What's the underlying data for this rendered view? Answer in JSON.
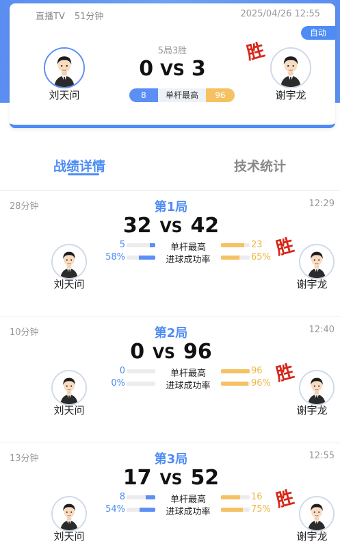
{
  "header": {
    "source": "直播TV",
    "duration": "51分钟",
    "datetime": "2025/04/26 12:55",
    "auto_label": "自动"
  },
  "match": {
    "format": "5局3胜",
    "left_player": "刘天问",
    "right_player": "谢宇龙",
    "left_score": "0",
    "right_score": "3",
    "vs": "VS",
    "highest_break_label": "单杆最高",
    "left_highest_break": "8",
    "right_highest_break": "96",
    "win_mark": "胜"
  },
  "tabs": [
    {
      "label": "战绩详情",
      "active": true
    },
    {
      "label": "技术统计",
      "active": false
    }
  ],
  "frames": [
    {
      "title": "第1局",
      "duration": "28分钟",
      "time": "12:29",
      "left_score": "32",
      "right_score": "42",
      "left_player": "刘天问",
      "right_player": "谢宇龙",
      "winner": "right",
      "stats": [
        {
          "label": "单杆最高",
          "left": "5",
          "right": "23",
          "left_frac": 0.18,
          "right_frac": 0.82
        },
        {
          "label": "进球成功率",
          "left": "58%",
          "right": "65%",
          "left_frac": 0.58,
          "right_frac": 0.65
        }
      ]
    },
    {
      "title": "第2局",
      "duration": "10分钟",
      "time": "12:40",
      "left_score": "0",
      "right_score": "96",
      "left_player": "刘天问",
      "right_player": "谢宇龙",
      "winner": "right",
      "stats": [
        {
          "label": "单杆最高",
          "left": "0",
          "right": "96",
          "left_frac": 0.0,
          "right_frac": 1.0
        },
        {
          "label": "进球成功率",
          "left": "0%",
          "right": "96%",
          "left_frac": 0.0,
          "right_frac": 0.96
        }
      ]
    },
    {
      "title": "第3局",
      "duration": "13分钟",
      "time": "12:55",
      "left_score": "17",
      "right_score": "52",
      "left_player": "刘天问",
      "right_player": "谢宇龙",
      "winner": "right",
      "stats": [
        {
          "label": "单杆最高",
          "left": "8",
          "right": "16",
          "left_frac": 0.33,
          "right_frac": 0.67
        },
        {
          "label": "进球成功率",
          "left": "54%",
          "right": "75%",
          "left_frac": 0.54,
          "right_frac": 0.75
        }
      ]
    }
  ],
  "colors": {
    "accent_blue": "#4d8cf5",
    "accent_orange": "#f5c163",
    "win_red": "#d8261a"
  }
}
